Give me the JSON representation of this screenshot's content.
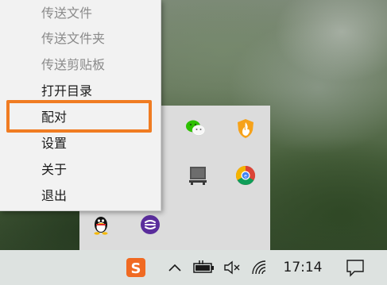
{
  "context_menu": {
    "items": [
      {
        "label": "传送文件",
        "enabled": false
      },
      {
        "label": "传送文件夹",
        "enabled": false
      },
      {
        "label": "传送剪贴板",
        "enabled": false
      },
      {
        "label": "打开目录",
        "enabled": true
      },
      {
        "label": "配对",
        "enabled": true,
        "highlighted": true
      },
      {
        "label": "设置",
        "enabled": true
      },
      {
        "label": "关于",
        "enabled": true
      },
      {
        "label": "退出",
        "enabled": true
      }
    ],
    "highlight_color": "#f07c22"
  },
  "tray_overflow": {
    "icons": [
      "wechat-icon",
      "fire-shield-icon",
      "device-icon",
      "chrome-icon",
      "qq-penguin-icon",
      "purple-app-icon"
    ]
  },
  "taskbar": {
    "clock": "17:14",
    "icons": [
      "sogou-input-icon",
      "chevron-up-icon",
      "battery-charging-icon",
      "volume-muted-icon",
      "wifi-icon",
      "notification-icon"
    ],
    "sogou_color": "#f06a22"
  }
}
